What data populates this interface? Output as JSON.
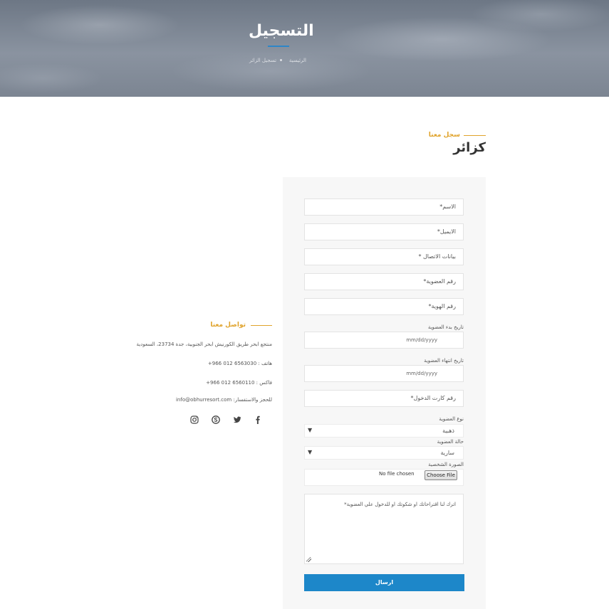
{
  "hero": {
    "title": "التسجيل",
    "breadcrumb_home": "الرئيسية",
    "breadcrumb_current": "تسجيل الزائر"
  },
  "section": {
    "subtitle": "سجل معنا",
    "title": "كزائر"
  },
  "form": {
    "name_placeholder": "الاسم*",
    "email_placeholder": "الايميل*",
    "contact_placeholder": "بيانات الاتصال *",
    "membership_number_placeholder": "رقم العضوية*",
    "id_number_placeholder": "رقم الهوية*",
    "start_date_label": "تاريخ بدء العضوية",
    "start_date_value": "mm/dd/yyyy",
    "end_date_label": "تاريخ انتهاء العضوية",
    "end_date_value": "mm/dd/yyyy",
    "entry_card_placeholder": "رقم كارت الدخول*",
    "membership_type_label": "نوع العضوية",
    "membership_type_value": "ذهبية",
    "membership_status_label": "حالة العضوية",
    "membership_status_value": "سارية",
    "photo_label": "الصورة الشخصية",
    "file_button": "Choose File",
    "file_status": "No file chosen",
    "message_placeholder": "اترك لنا اقتراحاتك او شكوتك او للدخول علي العضوية*",
    "submit_label": "ارسال"
  },
  "contact": {
    "title": "تواصل معنا",
    "address": "منتجع ابحر طريق الكورنيش ابحر الجنوبية، جدة 23734، السعودية",
    "phone": "هاتف : 6563030 012 966+",
    "fax": "فاكس : 6560110 012 966+",
    "email": "للحجز والاستفسار: info@obhurresort.com"
  },
  "social": [
    "facebook-icon",
    "twitter-icon",
    "skype-icon",
    "instagram-icon"
  ],
  "colors": {
    "accent": "#e0a32b",
    "primary": "#1d87c9"
  }
}
